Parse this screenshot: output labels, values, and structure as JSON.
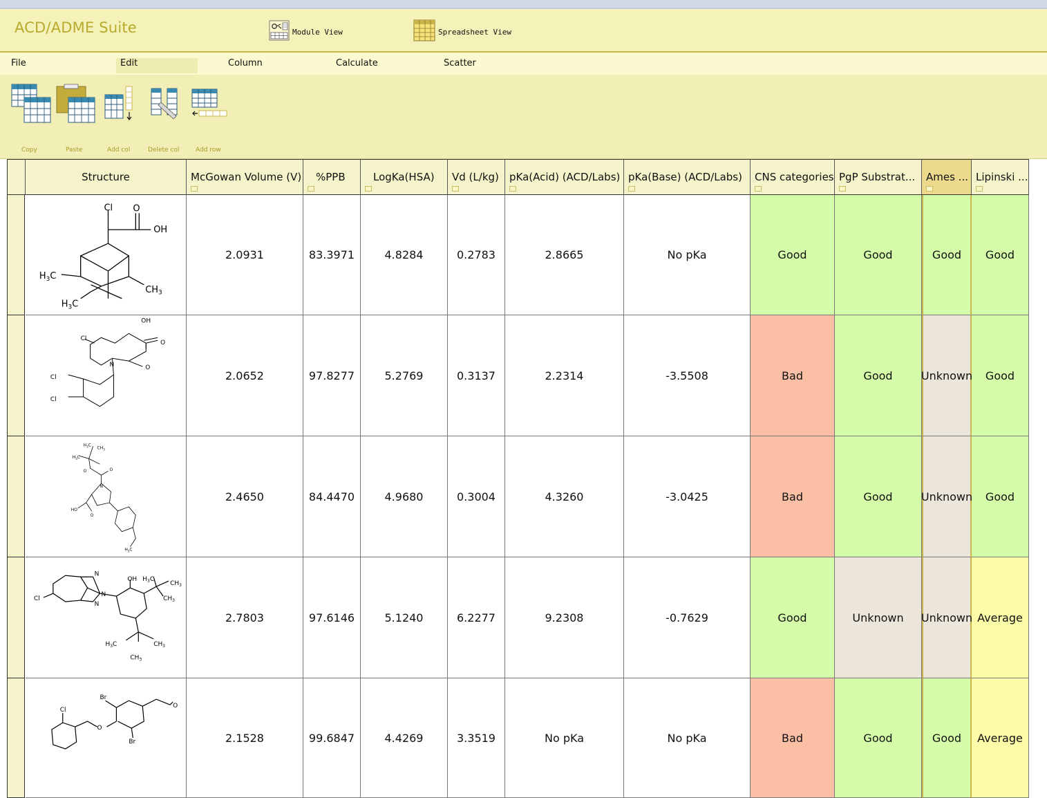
{
  "app": {
    "title": "ACD/ADME Suite",
    "views": [
      {
        "label": "Module View",
        "icon": "module-view-icon"
      },
      {
        "label": "Spreadsheet View",
        "icon": "spreadsheet-view-icon"
      }
    ]
  },
  "menu": [
    "File",
    "Edit",
    "Column",
    "Calculate",
    "Scatter"
  ],
  "ribbon": [
    {
      "label": "Copy",
      "icon": "copy-table-icon"
    },
    {
      "label": "Paste",
      "icon": "paste-table-icon"
    },
    {
      "label": "Add col",
      "icon": "add-column-icon"
    },
    {
      "label": "Delete col",
      "icon": "delete-column-icon"
    },
    {
      "label": "Add row",
      "icon": "add-row-icon"
    }
  ],
  "columns": [
    "Structure",
    "McGowan Volume (V)",
    "%PPB",
    "LogKa(HSA)",
    "Vd (L/kg)",
    "pKa(Acid) (ACD/Labs)",
    "pKa(Base) (ACD/Labs)",
    "CNS categories",
    "PgP Substrat...",
    "Ames ...",
    "Lipinski ..."
  ],
  "rows": [
    {
      "structure_labels": [
        "Cl",
        "O",
        "OH",
        "H3C",
        "CH3",
        "H3C"
      ],
      "mcgowan": "2.0931",
      "ppb": "83.3971",
      "logka": "4.8284",
      "vd": "0.2783",
      "pka_acid": "2.8665",
      "pka_base": "No pKa",
      "cns": "Good",
      "pgp": "Good",
      "ames": "Good",
      "lipinski": "Good"
    },
    {
      "structure_labels": [
        "OH",
        "O",
        "Cl",
        "N",
        "O",
        "Cl",
        "Cl"
      ],
      "mcgowan": "2.0652",
      "ppb": "97.8277",
      "logka": "5.2769",
      "vd": "0.3137",
      "pka_acid": "2.2314",
      "pka_base": "-3.5508",
      "cns": "Bad",
      "pgp": "Good",
      "ames": "Unknown",
      "lipinski": "Good"
    },
    {
      "structure_labels": [
        "H3C",
        "CH3",
        "H3C",
        "O",
        "O",
        "N",
        "HO",
        "O",
        "H3C"
      ],
      "mcgowan": "2.4650",
      "ppb": "84.4470",
      "logka": "4.9680",
      "vd": "0.3004",
      "pka_acid": "4.3260",
      "pka_base": "-3.0425",
      "cns": "Bad",
      "pgp": "Good",
      "ames": "Unknown",
      "lipinski": "Good"
    },
    {
      "structure_labels": [
        "N",
        "N",
        "N",
        "Cl",
        "OH",
        "H3C",
        "CH3",
        "CH3",
        "H3C",
        "CH3",
        "CH3"
      ],
      "mcgowan": "2.7803",
      "ppb": "97.6146",
      "logka": "5.1240",
      "vd": "6.2277",
      "pka_acid": "9.2308",
      "pka_base": "-0.7629",
      "cns": "Good",
      "pgp": "Unknown",
      "ames": "Unknown",
      "lipinski": "Average"
    },
    {
      "structure_labels": [
        "Br",
        "Cl",
        "O",
        "O",
        "Br"
      ],
      "mcgowan": "2.1528",
      "ppb": "99.6847",
      "logka": "4.4269",
      "vd": "3.3519",
      "pka_acid": "No pKa",
      "pka_base": "No pKa",
      "cns": "Bad",
      "pgp": "Good",
      "ames": "Good",
      "lipinski": "Average"
    }
  ],
  "colors": {
    "good": "#d5fca8",
    "bad": "#fbbfa5",
    "unknown": "#ece6da",
    "average": "#fcfca8",
    "title_bar": "#f4f2b8",
    "brand": "#b8aa2c"
  }
}
